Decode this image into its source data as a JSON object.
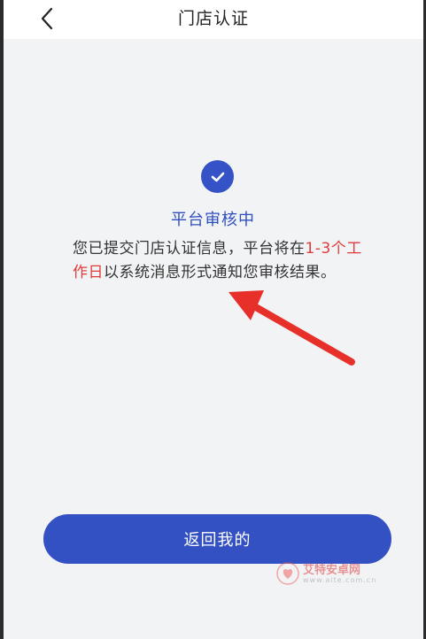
{
  "header": {
    "title": "门店认证"
  },
  "status": {
    "title": "平台审核中",
    "message_prefix": "您已提交门店认证信息，平台将在",
    "message_highlight": "1-3个工作日",
    "message_suffix": "以系统消息形式通知您审核结果。"
  },
  "actions": {
    "return_label": "返回我的"
  },
  "watermark": {
    "text": "艾特安卓网",
    "sub": "www.aite.com.cn"
  },
  "colors": {
    "accent": "#3451c3",
    "highlight": "#e03b3b",
    "annotation_arrow": "#e8302a",
    "background": "#f2f3f5"
  }
}
